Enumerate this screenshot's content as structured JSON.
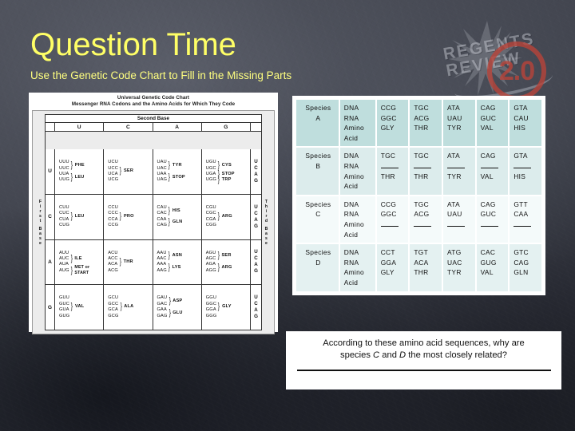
{
  "slide": {
    "title": "Question Time",
    "subtitle": "Use the Genetic Code Chart to Fill in the Missing Parts",
    "title_color": "#ffff66"
  },
  "watermark": {
    "line1": "REGENTS",
    "line2": "REVIEW",
    "badge": "2.0",
    "badge_color": "#b8443a"
  },
  "genetic_code_chart": {
    "title_line1": "Universal Genetic Code Chart",
    "title_line2": "Messenger RNA Codons and the Amino Acids for Which They Code",
    "second_base_label": "Second Base",
    "first_base_label": "First Base",
    "third_base_label": "Third Base",
    "column_headers": [
      "U",
      "C",
      "A",
      "G"
    ],
    "row_labels": [
      "U",
      "C",
      "A",
      "G"
    ],
    "third_base_letters": [
      "U",
      "C",
      "A",
      "G"
    ],
    "rows": [
      {
        "label": "U",
        "cells": [
          {
            "codons": [
              "UUU",
              "UUC",
              "UUA",
              "UUG"
            ],
            "groups": [
              {
                "aa": "PHE",
                "n": 2
              },
              {
                "aa": "LEU",
                "n": 2
              }
            ]
          },
          {
            "codons": [
              "UCU",
              "UCC",
              "UCA",
              "UCG"
            ],
            "groups": [
              {
                "aa": "SER",
                "n": 4
              }
            ]
          },
          {
            "codons": [
              "UAU",
              "UAC",
              "UAA",
              "UAG"
            ],
            "groups": [
              {
                "aa": "TYR",
                "n": 2
              },
              {
                "aa": "STOP",
                "n": 2
              }
            ]
          },
          {
            "codons": [
              "UGU",
              "UGC",
              "UGA",
              "UGG"
            ],
            "groups": [
              {
                "aa": "CYS",
                "n": 2
              },
              {
                "aa": "STOP",
                "n": 1
              },
              {
                "aa": "TRP",
                "n": 1
              }
            ]
          }
        ]
      },
      {
        "label": "C",
        "cells": [
          {
            "codons": [
              "CUU",
              "CUC",
              "CUA",
              "CUG"
            ],
            "groups": [
              {
                "aa": "LEU",
                "n": 4
              }
            ]
          },
          {
            "codons": [
              "CCU",
              "CCC",
              "CCA",
              "CCG"
            ],
            "groups": [
              {
                "aa": "PRO",
                "n": 4
              }
            ]
          },
          {
            "codons": [
              "CAU",
              "CAC",
              "CAA",
              "CAG"
            ],
            "groups": [
              {
                "aa": "HIS",
                "n": 2
              },
              {
                "aa": "GLN",
                "n": 2
              }
            ]
          },
          {
            "codons": [
              "CGU",
              "CGC",
              "CGA",
              "CGG"
            ],
            "groups": [
              {
                "aa": "ARG",
                "n": 4
              }
            ]
          }
        ]
      },
      {
        "label": "A",
        "cells": [
          {
            "codons": [
              "AUU",
              "AUC",
              "AUA",
              "AUG"
            ],
            "groups": [
              {
                "aa": "ILE",
                "n": 3
              },
              {
                "aa": "MET or START",
                "n": 1
              }
            ]
          },
          {
            "codons": [
              "ACU",
              "ACC",
              "ACA",
              "ACG"
            ],
            "groups": [
              {
                "aa": "THR",
                "n": 4
              }
            ]
          },
          {
            "codons": [
              "AAU",
              "AAC",
              "AAA",
              "AAG"
            ],
            "groups": [
              {
                "aa": "ASN",
                "n": 2
              },
              {
                "aa": "LYS",
                "n": 2
              }
            ]
          },
          {
            "codons": [
              "AGU",
              "AGC",
              "AGA",
              "AGG"
            ],
            "groups": [
              {
                "aa": "SER",
                "n": 2
              },
              {
                "aa": "ARG",
                "n": 2
              }
            ]
          }
        ]
      },
      {
        "label": "G",
        "cells": [
          {
            "codons": [
              "GUU",
              "GUC",
              "GUA",
              "GUG"
            ],
            "groups": [
              {
                "aa": "VAL",
                "n": 4
              }
            ]
          },
          {
            "codons": [
              "GCU",
              "GCC",
              "GCA",
              "GCG"
            ],
            "groups": [
              {
                "aa": "ALA",
                "n": 4
              }
            ]
          },
          {
            "codons": [
              "GAU",
              "GAC",
              "GAA",
              "GAG"
            ],
            "groups": [
              {
                "aa": "ASP",
                "n": 2
              },
              {
                "aa": "GLU",
                "n": 2
              }
            ]
          },
          {
            "codons": [
              "GGU",
              "GGC",
              "GGA",
              "GGG"
            ],
            "groups": [
              {
                "aa": "GLY",
                "n": 4
              }
            ]
          }
        ]
      }
    ]
  },
  "species_table": {
    "row_header_labels": [
      "DNA",
      "RNA",
      "Amino",
      "Acid"
    ],
    "rows": [
      {
        "species": "Species A",
        "name_line1": "Species",
        "name_line2": "A",
        "columns": [
          {
            "dna": "CCG",
            "rna": "GGC",
            "aa": "GLY"
          },
          {
            "dna": "TGC",
            "rna": "ACG",
            "aa": "THR"
          },
          {
            "dna": "ATA",
            "rna": "UAU",
            "aa": "TYR"
          },
          {
            "dna": "CAG",
            "rna": "GUC",
            "aa": "VAL"
          },
          {
            "dna": "GTA",
            "rna": "CAU",
            "aa": "HIS"
          }
        ]
      },
      {
        "species": "Species B",
        "name_line1": "Species",
        "name_line2": "B",
        "columns": [
          {
            "dna": "TGC",
            "rna": "",
            "aa": "THR"
          },
          {
            "dna": "TGC",
            "rna": "",
            "aa": "THR"
          },
          {
            "dna": "ATA",
            "rna": "",
            "aa": "TYR"
          },
          {
            "dna": "CAG",
            "rna": "",
            "aa": "VAL"
          },
          {
            "dna": "GTA",
            "rna": "",
            "aa": "HIS"
          }
        ]
      },
      {
        "species": "Species C",
        "name_line1": "Species",
        "name_line2": "C",
        "columns": [
          {
            "dna": "CCG",
            "rna": "GGC",
            "aa": ""
          },
          {
            "dna": "TGC",
            "rna": "ACG",
            "aa": ""
          },
          {
            "dna": "ATA",
            "rna": "UAU",
            "aa": ""
          },
          {
            "dna": "CAG",
            "rna": "GUC",
            "aa": ""
          },
          {
            "dna": "GTT",
            "rna": "CAA",
            "aa": ""
          }
        ]
      },
      {
        "species": "Species D",
        "name_line1": "Species",
        "name_line2": "D",
        "columns": [
          {
            "dna": "CCT",
            "rna": "GGA",
            "aa": "GLY"
          },
          {
            "dna": "TGT",
            "rna": "ACA",
            "aa": "THR"
          },
          {
            "dna": "ATG",
            "rna": "UAC",
            "aa": "TYR"
          },
          {
            "dna": "CAC",
            "rna": "GUG",
            "aa": "VAL"
          },
          {
            "dna": "GTC",
            "rna": "CAG",
            "aa": "GLN"
          }
        ]
      }
    ]
  },
  "question": {
    "line1_a": "According to these amino acid sequences, why are",
    "line2_a": "species ",
    "line2_c": "C",
    "line2_b": " and ",
    "line2_d": "D",
    "line2_e": " the most closely related?"
  }
}
